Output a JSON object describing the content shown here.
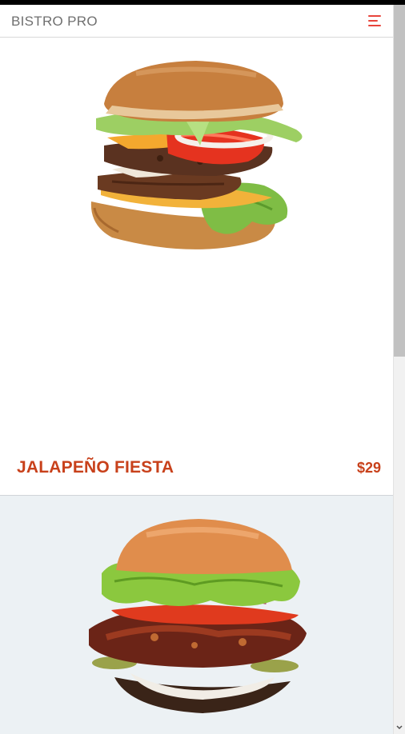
{
  "app": {
    "brand": "BISTRO PRO"
  },
  "navbar": {
    "menu_icon": "hamburger-menu-icon"
  },
  "menu_items": [
    {
      "name": "JALAPEÑO FIESTA",
      "price": "$29"
    },
    {
      "name": "",
      "price": ""
    }
  ],
  "colors": {
    "accent": "#c8411b",
    "menu_icon": "#e8443b",
    "card_alt_bg": "#ecf1f4"
  },
  "scroll": {
    "icon": "chevron-down-icon",
    "position_fraction": 0.0
  }
}
